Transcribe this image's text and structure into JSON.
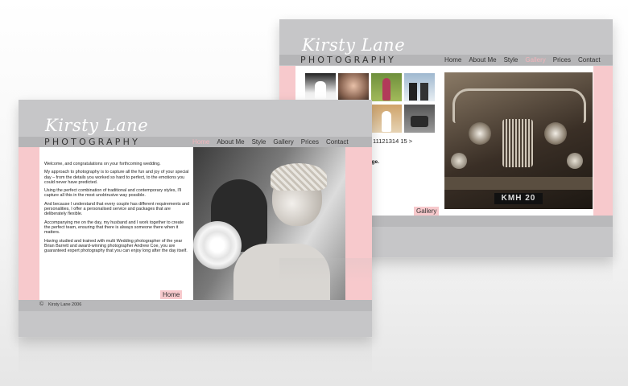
{
  "brand": {
    "script": "Kirsty Lane",
    "word": "PHOTOGRAPHY"
  },
  "front": {
    "nav": [
      "Home",
      "About Me",
      "Style",
      "Gallery",
      "Prices",
      "Contact"
    ],
    "active": "Home",
    "paragraphs": [
      "Welcome, and congratulations on your forthcoming wedding.",
      "My approach to photography is to capture all the fun and joy of your special day – from the details you worked so hard to perfect, to the emotions you could never have predicted.",
      "Using the perfect combination of traditional and contemporary styles, I'll capture all this in the most unobtrusive way possible.",
      "And because I understand that every couple has different requirements and personalities, I offer a personalised service and packages that are deliberately flexible.",
      "Accompanying me on the day, my husband and I work together to create the perfect team, ensuring that there is always someone there when it matters.",
      "Having studied and trained with multi Wedding photographer of the year Brian Barrett and award-winning photographer Andrew Coe, you are guaranteed expert photography that you can enjoy long after the day itself."
    ],
    "tab_label": "Home",
    "copyright_symbol": "©",
    "copyright": "Kirsty Lane 2006"
  },
  "back": {
    "nav": [
      "Home",
      "About Me",
      "Style",
      "Gallery",
      "Prices",
      "Contact"
    ],
    "active": "Gallery",
    "pagination": "11121314 15 >",
    "bold_fragment": "rge.",
    "tab_label": "Gallery",
    "plate": "KMH 20"
  }
}
